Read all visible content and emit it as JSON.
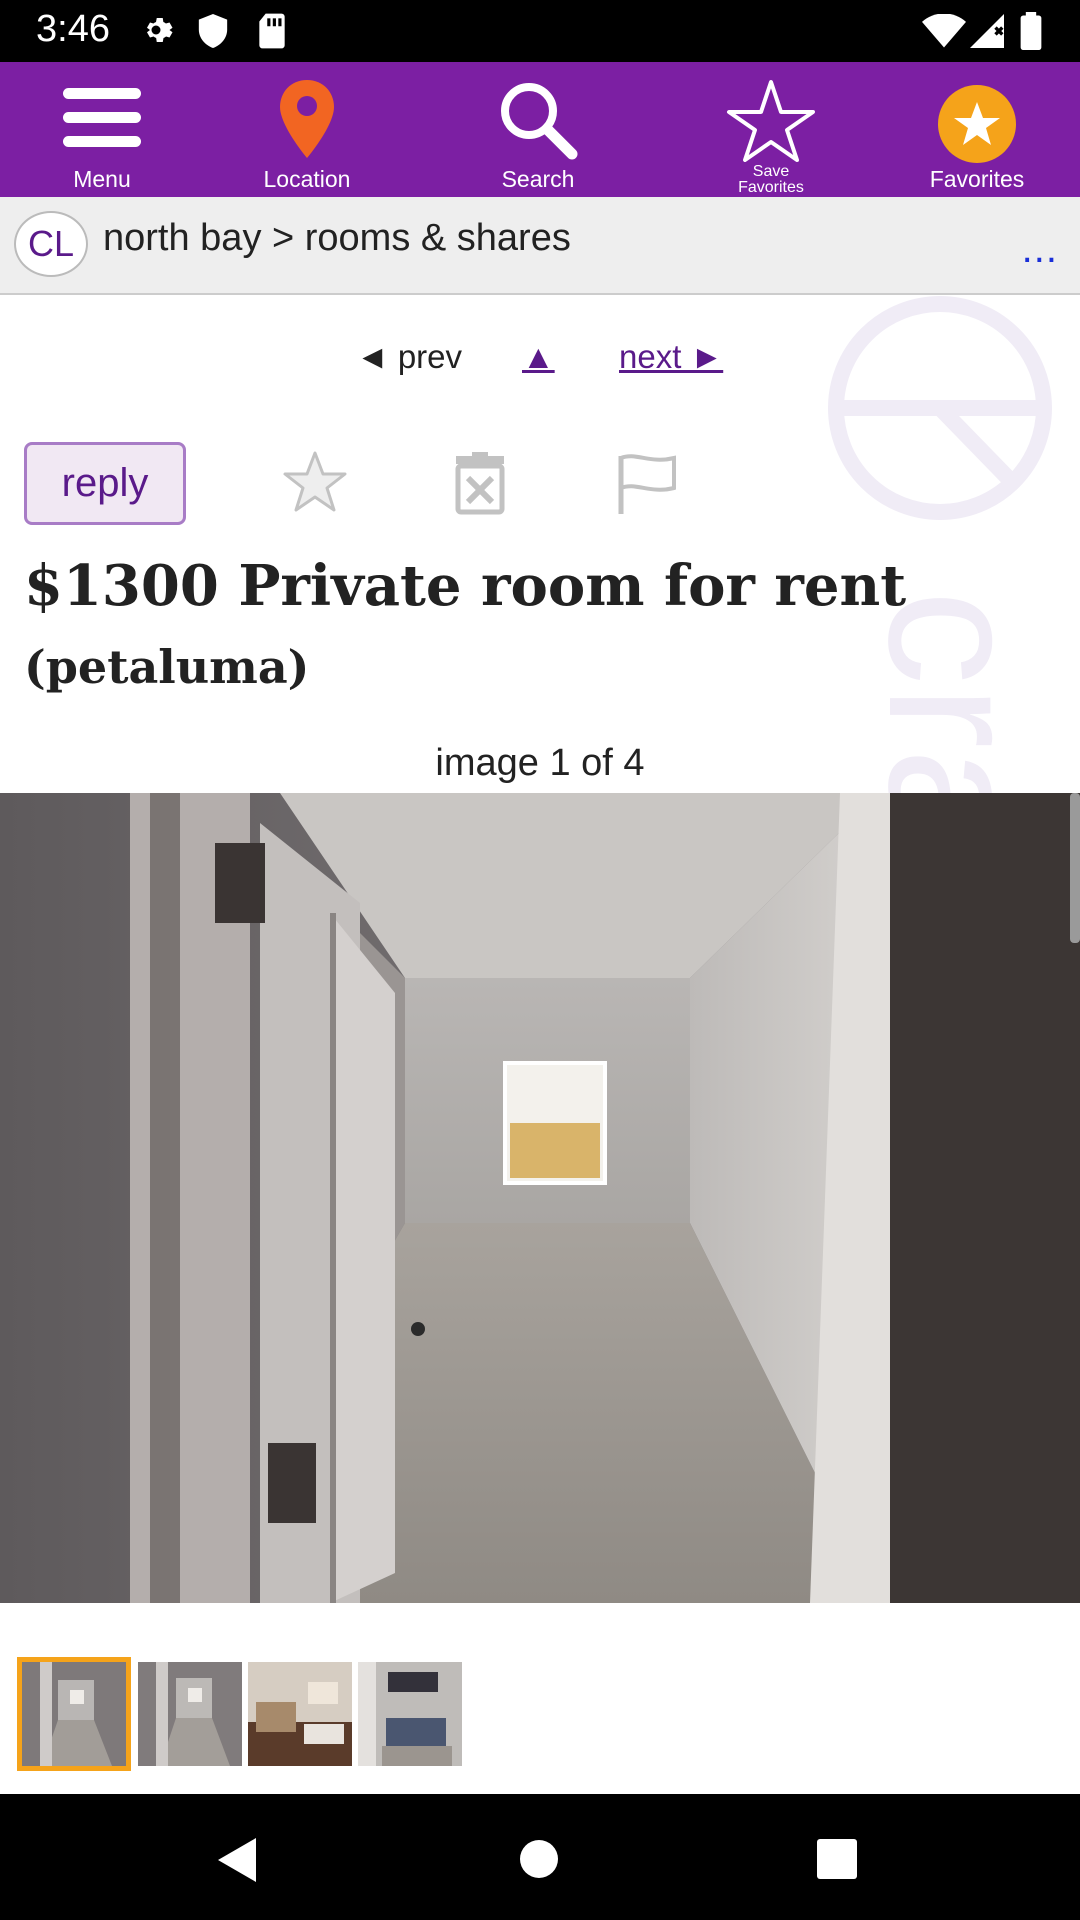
{
  "status_bar": {
    "time": "3:46",
    "icons": [
      "settings-icon",
      "shield-icon",
      "sd-card-icon",
      "wifi-icon",
      "signal-icon",
      "battery-icon"
    ]
  },
  "toolbar": {
    "background": "#7c1fa3",
    "items": [
      {
        "label": "Menu",
        "icon": "menu-icon"
      },
      {
        "label": "Location",
        "icon": "location-pin-icon"
      },
      {
        "label": "Search",
        "icon": "search-icon"
      },
      {
        "label": "Save Favorites",
        "line1": "Save",
        "line2": "Favorites",
        "icon": "star-outline-icon"
      },
      {
        "label": "Favorites",
        "icon": "favorites-star-icon"
      }
    ]
  },
  "breadcrumb": {
    "logo": "CL",
    "path": "north bay > rooms & shares",
    "more": "..."
  },
  "nav": {
    "prev": "◄ prev",
    "up": "▲",
    "next": "next ►"
  },
  "actions": {
    "reply": "reply",
    "icons": [
      "favorite-star-icon",
      "hide-icon",
      "flag-icon"
    ]
  },
  "listing": {
    "title": "$1300 Private room for rent",
    "location": "(petaluma)",
    "image_caption": "image 1 of 4",
    "image_count": 4,
    "selected_image": 1
  },
  "colors": {
    "accent": "#7c1fa3",
    "link": "#5a1a8a",
    "thumb_selected": "#f5a31a",
    "favorites_badge": "#f5a31a",
    "location_pin": "#f26522"
  }
}
